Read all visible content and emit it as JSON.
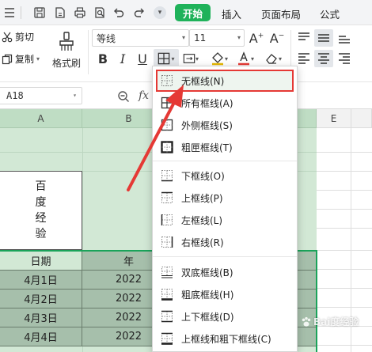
{
  "toolbar": {
    "start_label": "开始",
    "tabs": [
      "插入",
      "页面布局",
      "公式"
    ]
  },
  "ribbon": {
    "cut_label": "剪切",
    "copy_label": "复制",
    "painter_label": "格式刷",
    "font_name": "等线",
    "font_size": "11",
    "bold_label": "B",
    "italic_label": "I",
    "underline_label": "U"
  },
  "formula_bar": {
    "cell_ref": "A18",
    "fx_label": "fx"
  },
  "sheet": {
    "columns": [
      "A",
      "B",
      "E"
    ],
    "merged_text": [
      "百",
      "度",
      "经",
      "验"
    ],
    "table_headers": [
      "日期",
      "年"
    ],
    "rows": [
      [
        "4月1日",
        "2022"
      ],
      [
        "4月2日",
        "2022"
      ],
      [
        "4月3日",
        "2022"
      ],
      [
        "4月4日",
        "2022"
      ]
    ]
  },
  "border_menu": {
    "items": [
      {
        "label": "无框线(N)",
        "icon": "no-border-icon",
        "highlighted": true
      },
      {
        "label": "所有框线(A)",
        "icon": "all-borders-icon"
      },
      {
        "label": "外侧框线(S)",
        "icon": "outside-borders-icon"
      },
      {
        "label": "粗匣框线(T)",
        "icon": "thick-box-border-icon"
      },
      {
        "label": "下框线(O)",
        "icon": "bottom-border-icon"
      },
      {
        "label": "上框线(P)",
        "icon": "top-border-icon"
      },
      {
        "label": "左框线(L)",
        "icon": "left-border-icon"
      },
      {
        "label": "右框线(R)",
        "icon": "right-border-icon"
      },
      {
        "label": "双底框线(B)",
        "icon": "double-bottom-border-icon"
      },
      {
        "label": "粗底框线(H)",
        "icon": "thick-bottom-border-icon"
      },
      {
        "label": "上下框线(D)",
        "icon": "top-bottom-border-icon"
      },
      {
        "label": "上框线和粗下框线(C)",
        "icon": "top-thick-bottom-border-icon"
      }
    ]
  },
  "watermark": "Bai度经验",
  "colors": {
    "accent_green": "#1fb25a",
    "highlight_red": "#e53935",
    "sheet_fill": "#d2e8d5",
    "data_fill": "#a6bfab"
  }
}
